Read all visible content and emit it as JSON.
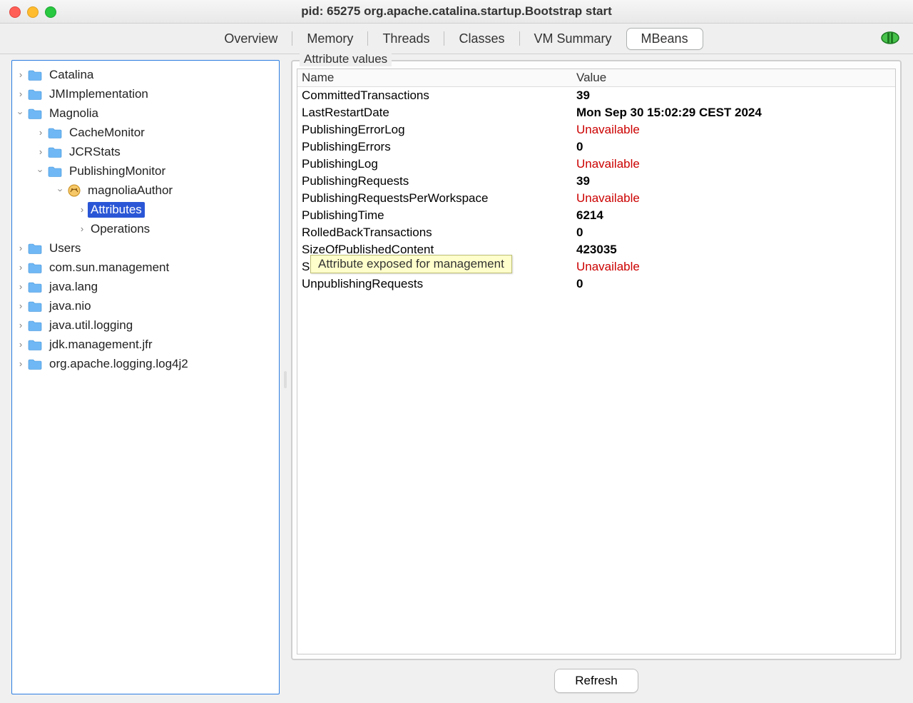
{
  "window": {
    "title": "pid: 65275 org.apache.catalina.startup.Bootstrap start"
  },
  "tabs": {
    "overview": "Overview",
    "memory": "Memory",
    "threads": "Threads",
    "classes": "Classes",
    "vm_summary": "VM Summary",
    "mbeans": "MBeans"
  },
  "tree": {
    "catalina": "Catalina",
    "jmimplementation": "JMImplementation",
    "magnolia": "Magnolia",
    "cache_monitor": "CacheMonitor",
    "jcr_stats": "JCRStats",
    "publishing_monitor": "PublishingMonitor",
    "magnolia_author": "magnoliaAuthor",
    "attributes": "Attributes",
    "operations": "Operations",
    "users": "Users",
    "com_sun_management": "com.sun.management",
    "java_lang": "java.lang",
    "java_nio": "java.nio",
    "java_util_logging": "java.util.logging",
    "jdk_management_jfr": "jdk.management.jfr",
    "log4j2": "org.apache.logging.log4j2"
  },
  "panel": {
    "legend": "Attribute values",
    "col_name": "Name",
    "col_value": "Value",
    "refresh": "Refresh"
  },
  "attributes": [
    {
      "name": "CommittedTransactions",
      "value": "39",
      "unavailable": false
    },
    {
      "name": "LastRestartDate",
      "value": "Mon Sep 30 15:02:29 CEST 2024",
      "unavailable": false
    },
    {
      "name": "PublishingErrorLog",
      "value": "Unavailable",
      "unavailable": true
    },
    {
      "name": "PublishingErrors",
      "value": "0",
      "unavailable": false
    },
    {
      "name": "PublishingLog",
      "value": "Unavailable",
      "unavailable": true
    },
    {
      "name": "PublishingRequests",
      "value": "39",
      "unavailable": false
    },
    {
      "name": "PublishingRequestsPerWorkspace",
      "value": "Unavailable",
      "unavailable": true
    },
    {
      "name": "PublishingTime",
      "value": "6214",
      "unavailable": false
    },
    {
      "name": "RolledBackTransactions",
      "value": "0",
      "unavailable": false
    },
    {
      "name": "SizeOfPublishedContent",
      "value": "423035",
      "unavailable": false
    },
    {
      "name": "SubscriberResponseTimes",
      "value": "Unavailable",
      "unavailable": true
    },
    {
      "name": "UnpublishingRequests",
      "value": "0",
      "unavailable": false
    }
  ],
  "tooltip": "Attribute exposed for management"
}
